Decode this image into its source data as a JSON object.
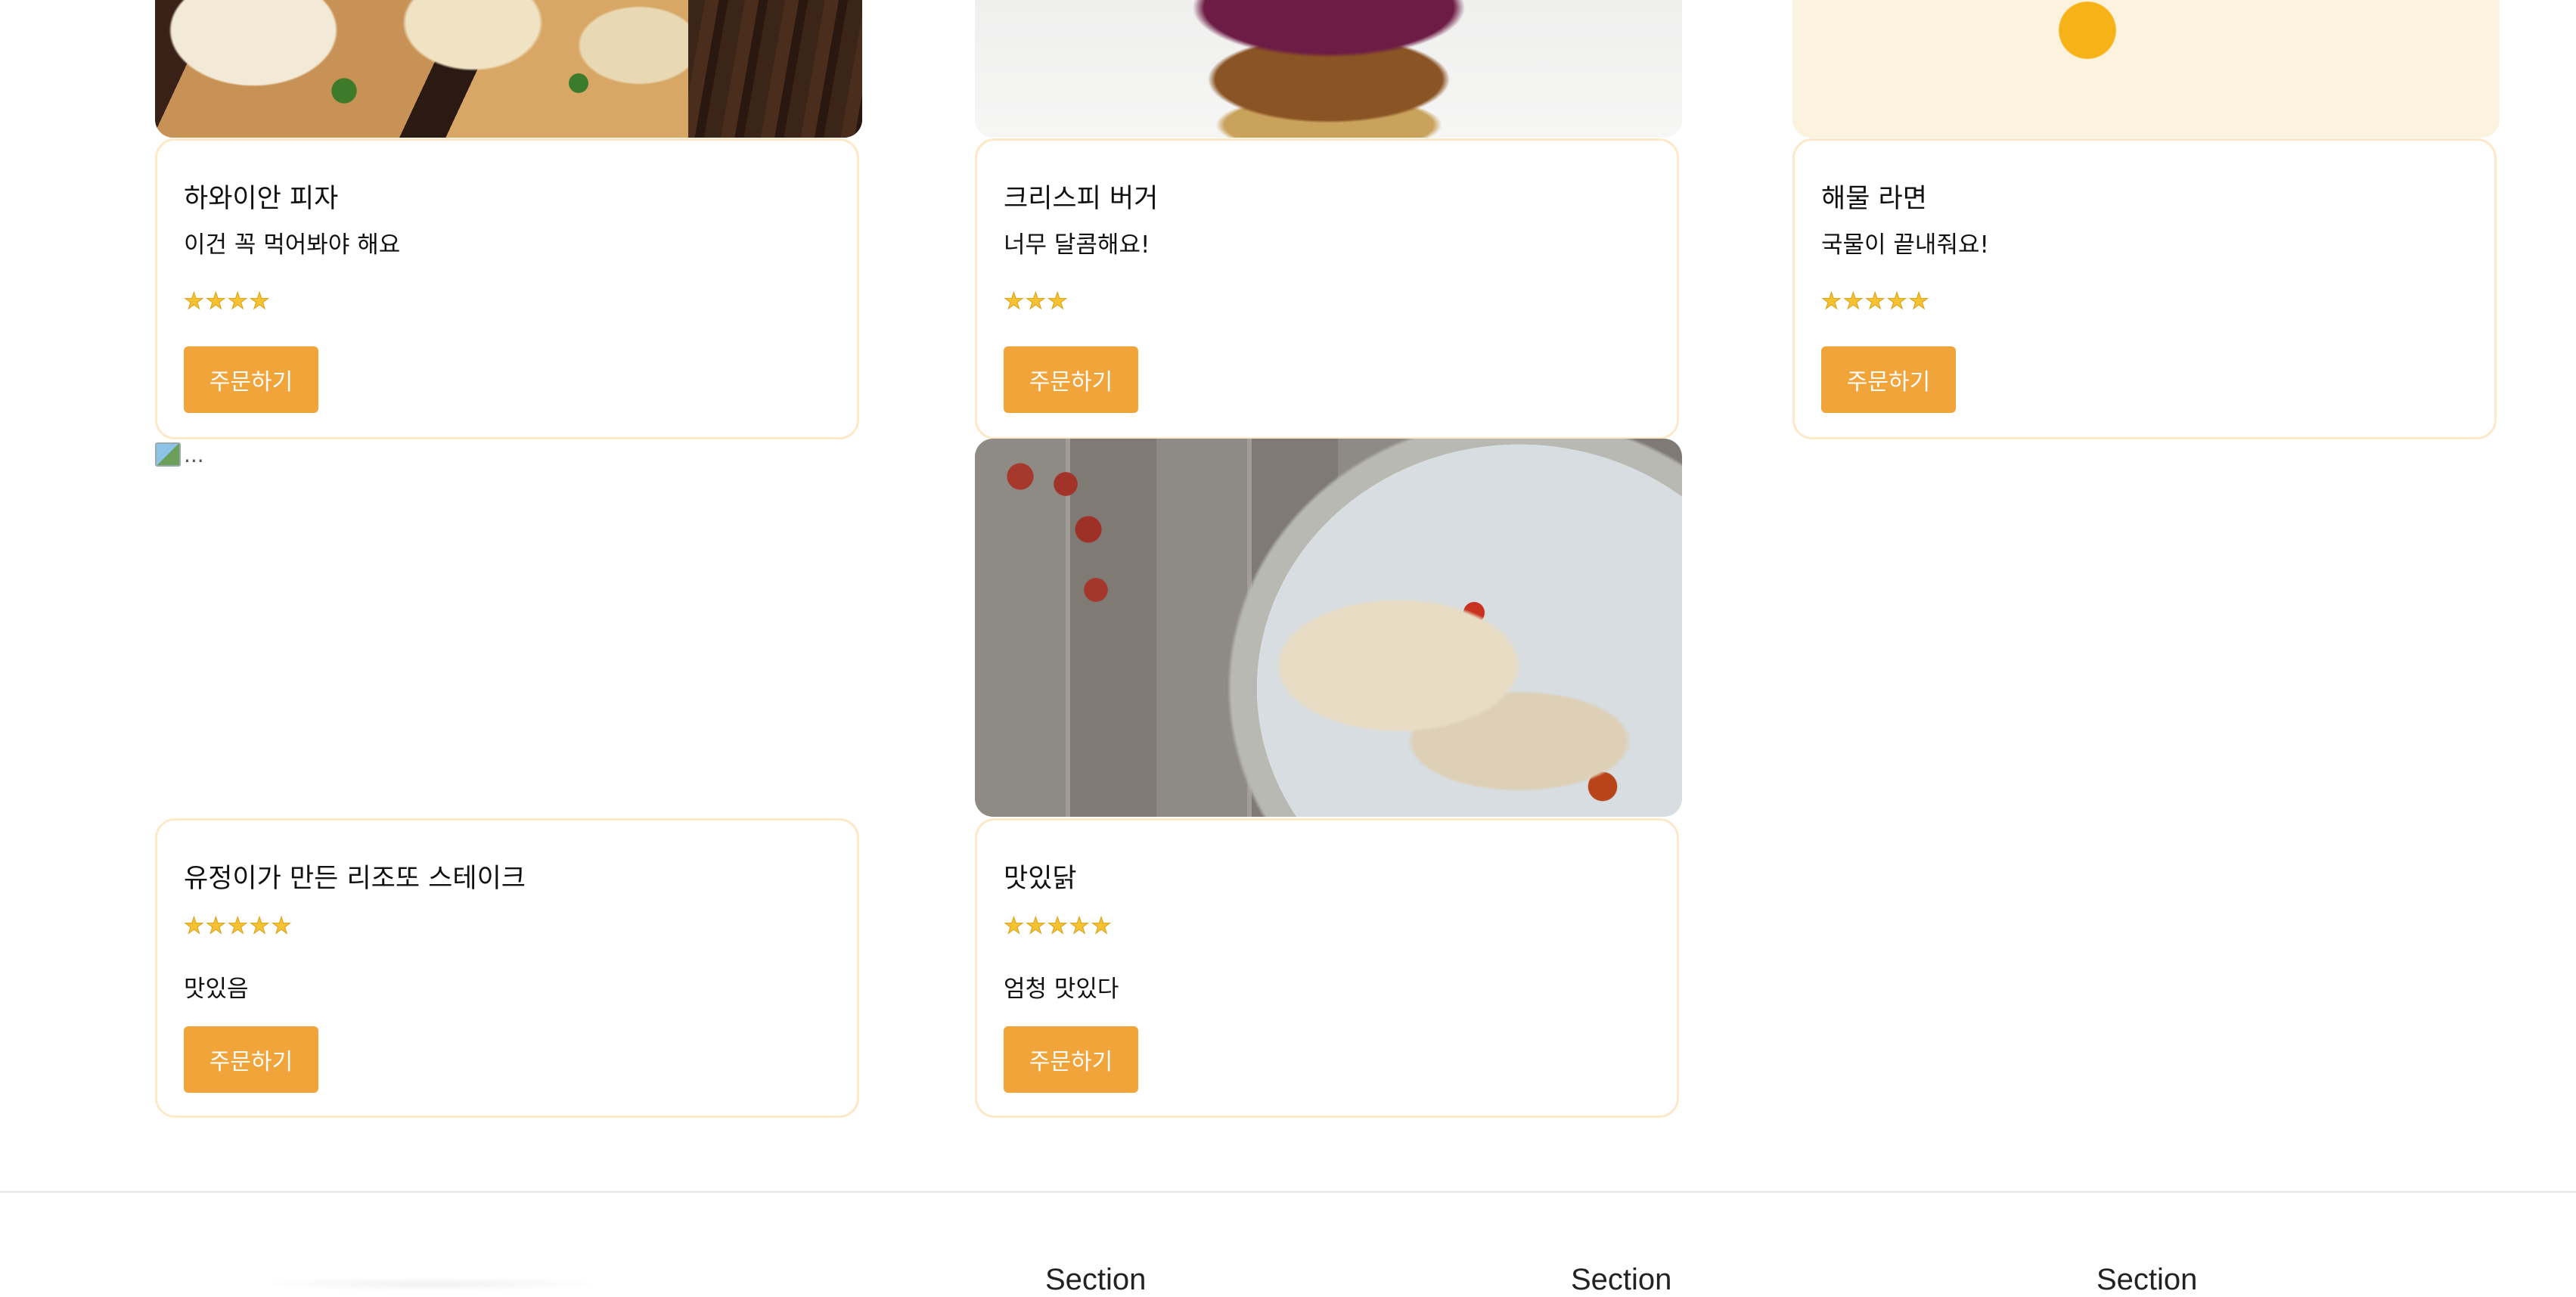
{
  "menu_items": [
    {
      "name": "하와이안 피자",
      "desc": "이건 꼭 먹어봐야 해요",
      "stars": "★★★★",
      "rating": 4,
      "button": "주문하기"
    },
    {
      "name": "크리스피 버거",
      "desc": "너무 달콤해요!",
      "stars": "★★★",
      "rating": 3,
      "button": "주문하기"
    },
    {
      "name": "해물 라면",
      "desc": "국물이 끝내줘요!",
      "stars": "★★★★★",
      "rating": 5,
      "button": "주문하기"
    },
    {
      "name": "유정이가 만든 리조또 스테이크",
      "desc": "맛있음",
      "stars": "★★★★★",
      "rating": 5,
      "button": "주문하기",
      "image_alt": "..."
    },
    {
      "name": "맛있닭",
      "desc": "엄청 맛있다",
      "stars": "★★★★★",
      "rating": 5,
      "button": "주문하기"
    }
  ],
  "footer": {
    "sections": [
      "Section",
      "Section",
      "Section"
    ]
  },
  "colors": {
    "accent": "#f0a43a",
    "card_border": "#fde8c8",
    "star": "#f6c231"
  },
  "icons": {
    "rating": "star-icon",
    "broken_image": "broken-image-icon"
  }
}
